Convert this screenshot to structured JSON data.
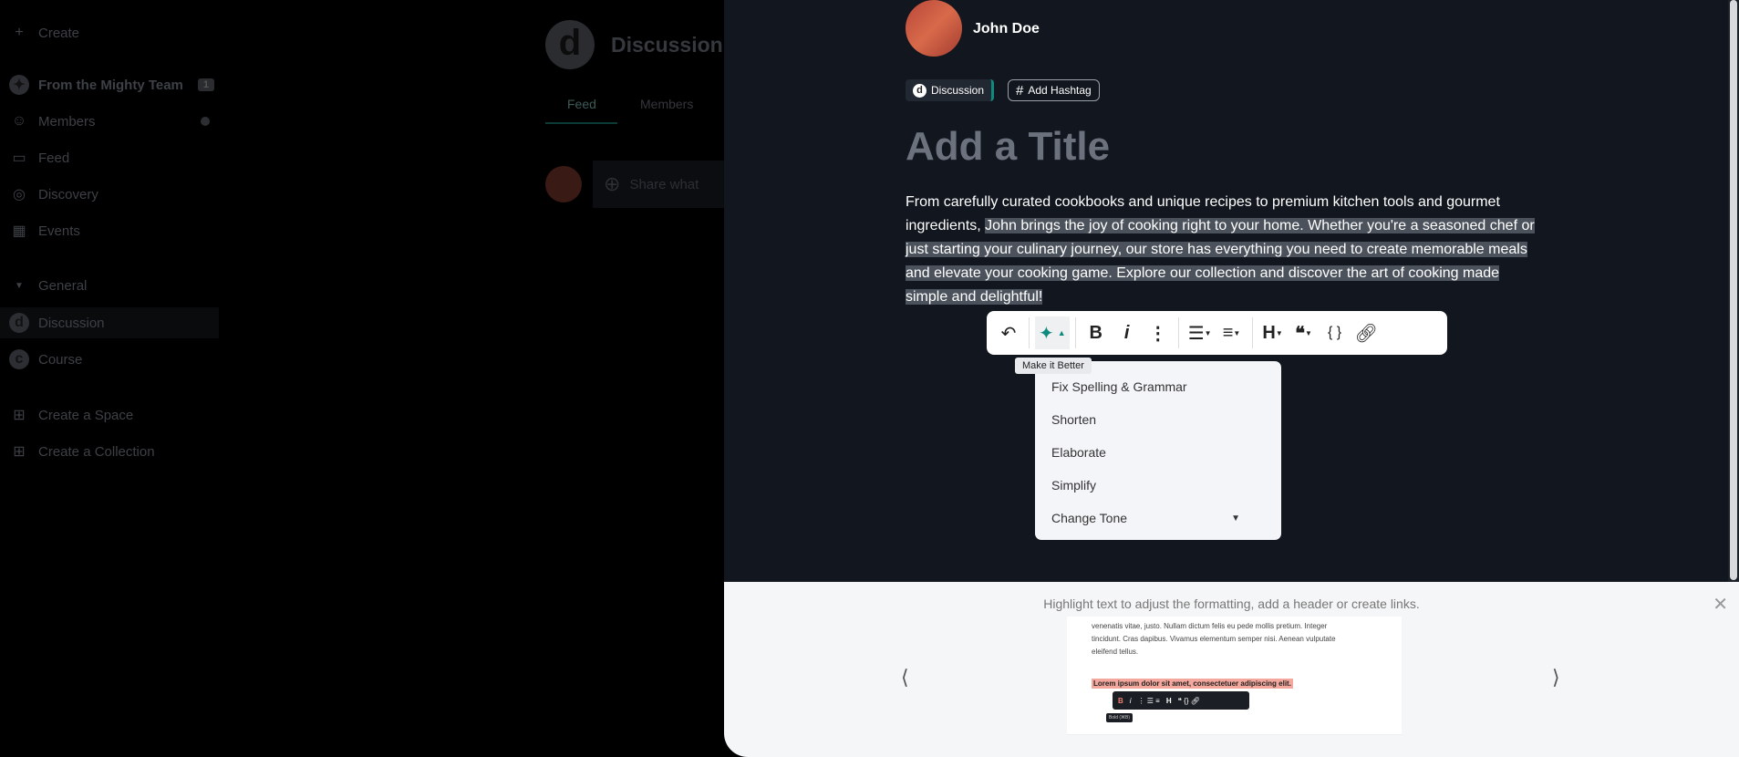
{
  "sidebar": {
    "create": "Create",
    "team": "From the Mighty Team",
    "team_badge": "1",
    "members": "Members",
    "feed": "Feed",
    "discovery": "Discovery",
    "events": "Events",
    "general": "General",
    "discussion": "Discussion",
    "course": "Course",
    "create_space": "Create a Space",
    "create_collection": "Create a Collection"
  },
  "space": {
    "title": "Discussion",
    "tabs": [
      "Feed",
      "Members"
    ],
    "composer_placeholder": "Share what"
  },
  "post": {
    "author": "John Doe",
    "space_chip": "Discussion",
    "hashtag": "Add Hashtag",
    "title_placeholder": "Add a Title",
    "body_plain": "From carefully curated cookbooks and unique recipes to premium kitchen tools and gourmet ingredients, ",
    "body_selected": "John brings the joy of cooking right to your home. Whether you're a seasoned chef or just starting your culinary journey, our store has everything you need to create memorable meals and elevate your cooking game. Explore our collection and discover the art of cooking made simple and delightful!"
  },
  "toolbar": {
    "tooltip": "Make it Better",
    "accent": "#0f8a7e"
  },
  "ai_menu": [
    "Fix Spelling & Grammar",
    "Shorten",
    "Elaborate",
    "Simplify",
    "Change Tone"
  ],
  "tutorial": {
    "hint": "Highlight text to adjust the formatting, add a header or create links.",
    "preview_text": "venenatis vitae, justo. Nullam dictum felis eu pede mollis pretium. Integer tincidunt. Cras dapibus. Vivamus elementum semper nisi. Aenean vulputate eleifend tellus.",
    "preview_highlight": "Lorem ipsum dolor sit amet, consectetuer adipiscing elit.",
    "preview_tooltip": "Bold (⌘B)"
  }
}
